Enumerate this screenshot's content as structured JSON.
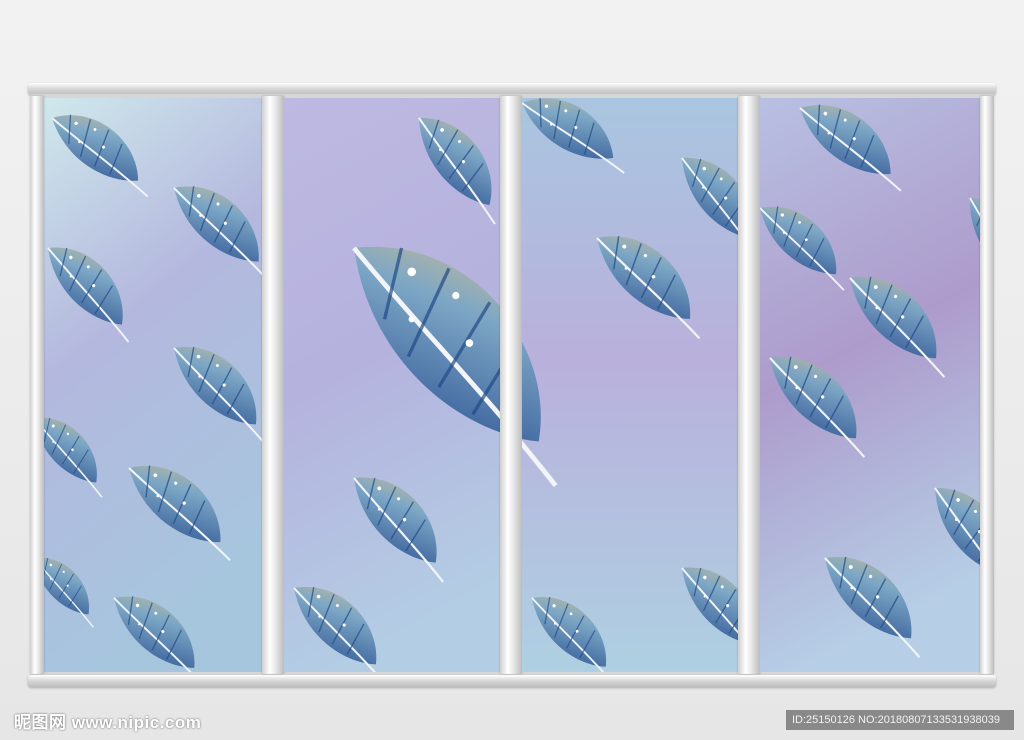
{
  "watermark": {
    "site": "昵图网 www.nipic.com",
    "id_text": "ID:25150126 NO:20180807133531938039"
  },
  "colors": {
    "sky_light": "#cde6ea",
    "sky_mid": "#b7b4df",
    "sky_purple": "#a893c8",
    "feather_blue": "#3f6fb0",
    "feather_dark": "#2a4f8e",
    "feather_tip": "#c7b790",
    "frame_silver": "#d9d9d9"
  },
  "panels": [
    {
      "name": "panel-1"
    },
    {
      "name": "panel-2"
    },
    {
      "name": "panel-3"
    },
    {
      "name": "panel-4"
    }
  ]
}
